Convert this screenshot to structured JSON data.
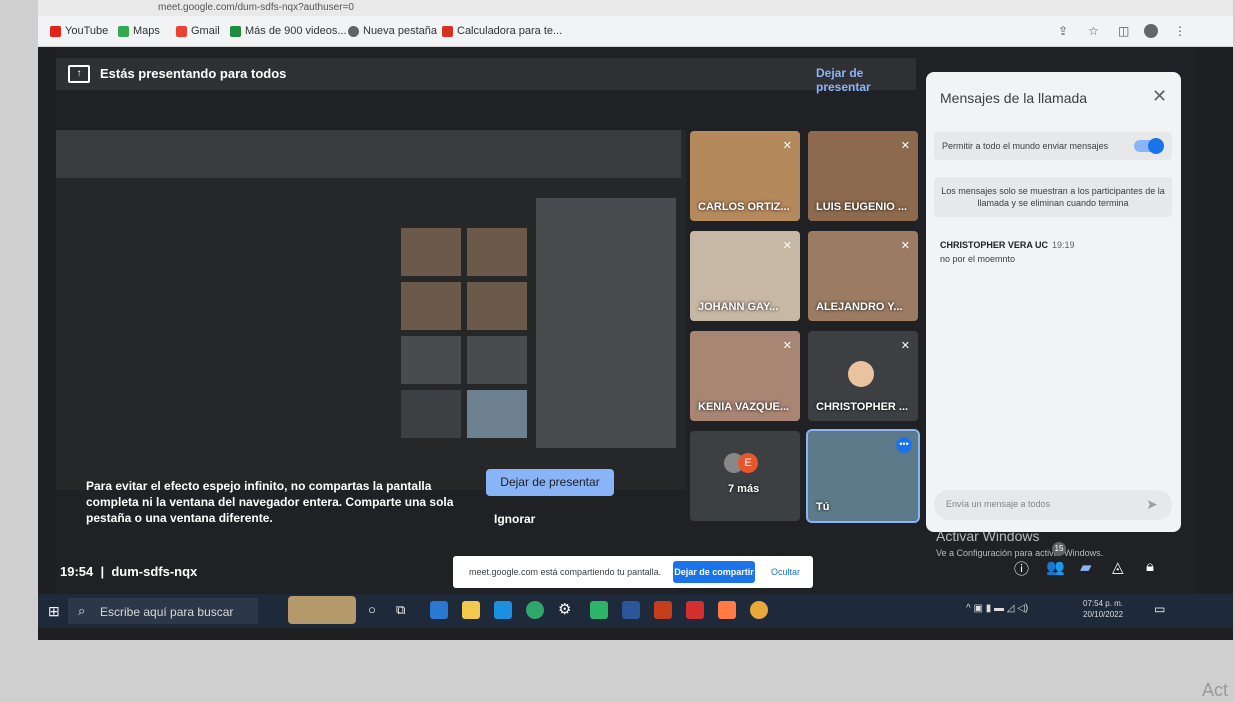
{
  "browser": {
    "url": "meet.google.com/dum-sdfs-nqx?authuser=0",
    "bookmarks": [
      {
        "label": "YouTube",
        "color": "#e62117"
      },
      {
        "label": "Maps",
        "color": "#34a853"
      },
      {
        "label": "Gmail",
        "color": "#ea4335"
      },
      {
        "label": "Más de 900 videos...",
        "color": "#1e8e3e"
      },
      {
        "label": "Nueva pestaña",
        "color": "#5f6368"
      },
      {
        "label": "Calculadora para te...",
        "color": "#d93025"
      }
    ]
  },
  "presenting": {
    "banner": "Estás presentando para todos",
    "stop_top": "Dejar de presentar"
  },
  "participants": [
    {
      "name": "CARLOS ORTIZ...",
      "muted": true,
      "bg": "#b48a5c"
    },
    {
      "name": "LUIS EUGENIO ...",
      "muted": true,
      "bg": "#8d6a4e"
    },
    {
      "name": "JOHANN GAY...",
      "muted": true,
      "bg": "#c7b7a5"
    },
    {
      "name": "ALEJANDRO Y...",
      "muted": true,
      "bg": "#9b7c63"
    },
    {
      "name": "KENIA VAZQUE...",
      "muted": true,
      "bg": "#a98574"
    },
    {
      "name": "CHRISTOPHER ...",
      "muted": true,
      "bg": "#3c4043"
    },
    {
      "name": "7 más",
      "muted": false,
      "bg": "#3c4043"
    },
    {
      "name": "Tú",
      "muted": false,
      "bg": "#5d7a8a"
    }
  ],
  "more_avatar_letter": "E",
  "chat": {
    "title": "Mensajes de la llamada",
    "permission": "Permitir a todo el mundo enviar mensajes",
    "info": "Los mensajes solo se muestran a los participantes de la llamada y se eliminan cuando termina",
    "messages": [
      {
        "author": "CHRISTOPHER VERA UC",
        "time": "19:19",
        "text": "no por el moemnto"
      }
    ],
    "input_placeholder": "Envía un mensaje a todos"
  },
  "warning": {
    "text": "Para evitar el efecto espejo infinito, no compartas la pantalla completa ni la ventana del navegador entera. Comparte una sola pestaña o una ventana diferente.",
    "stop_button": "Dejar de presentar",
    "ignore_button": "Ignorar"
  },
  "meeting": {
    "time": "19:54",
    "code": "dum-sdfs-nqx",
    "badge_count": "15"
  },
  "share_notice": {
    "text": "meet.google.com está compartiendo tu pantalla.",
    "stop": "Dejar de compartir",
    "hide": "Ocultar"
  },
  "windows": {
    "activate_title": "Activar Windows",
    "activate_sub": "Ve a Configuración para activar Windows.",
    "search_placeholder": "Escribe aquí para buscar",
    "clock_time": "07:54 p. m.",
    "clock_date": "20/10/2022",
    "corner_text": "Act"
  }
}
